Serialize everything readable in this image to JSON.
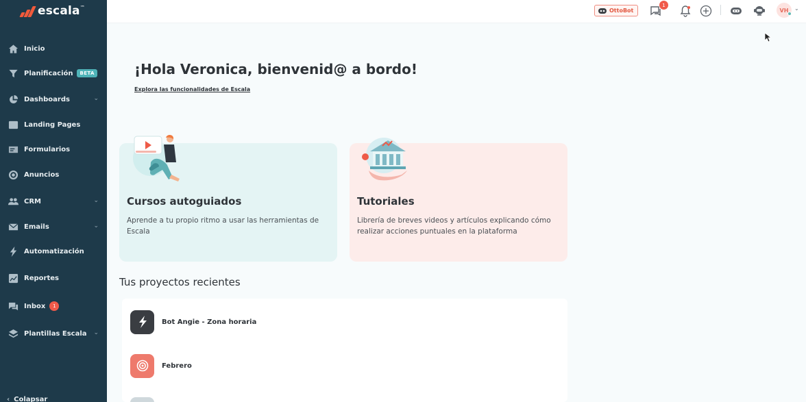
{
  "brand": {
    "name": "escala",
    "accent": "#f15a3b",
    "sidebar_bg": "#1e3a4a"
  },
  "sidebar": {
    "items": [
      {
        "label": "Inicio",
        "icon": "home-icon"
      },
      {
        "label": "Planificación",
        "icon": "funnel-icon",
        "tag": "BETA"
      },
      {
        "label": "Dashboards",
        "icon": "pie-chart-icon",
        "has_chevron": true
      },
      {
        "label": "Landing Pages",
        "icon": "landing-page-icon"
      },
      {
        "label": "Formularios",
        "icon": "form-icon"
      },
      {
        "label": "Anuncios",
        "icon": "target-icon"
      },
      {
        "label": "CRM",
        "icon": "users-icon",
        "has_chevron": true
      },
      {
        "label": "Emails",
        "icon": "envelope-icon",
        "has_chevron": true
      },
      {
        "label": "Automatización",
        "icon": "lightning-icon"
      },
      {
        "label": "Reportes",
        "icon": "report-icon"
      },
      {
        "label": "Inbox",
        "icon": "chat-icon",
        "badge": "1"
      },
      {
        "label": "Plantillas Escala",
        "icon": "layers-icon",
        "has_chevron": true
      }
    ],
    "collapse_label": "Colapsar"
  },
  "topbar": {
    "ottobot_label": "OttoBot",
    "messages_badge": "1",
    "avatar_initials": "VH"
  },
  "main": {
    "greeting": "¡Hola Veronica, bienvenid@ a bordo!",
    "explore_link": "Explora las funcionalidades de Escala",
    "cards": [
      {
        "title": "Cursos autoguiados",
        "description": "Aprende a tu propio ritmo a usar las herramientas de Escala"
      },
      {
        "title": "Tutoriales",
        "description_line1": "Librería de breves videos y artículos explicando cómo",
        "description_line2": "realizar acciones puntuales en la plataforma"
      }
    ],
    "recent_title": "Tus proyectos recientes",
    "recent_projects": [
      {
        "name": "Bot Angie - Zona horaria",
        "icon": "lightning-icon",
        "color": "#3a3d42"
      },
      {
        "name": "Febrero",
        "icon": "target-icon",
        "color": "#ee7a6c"
      }
    ]
  }
}
